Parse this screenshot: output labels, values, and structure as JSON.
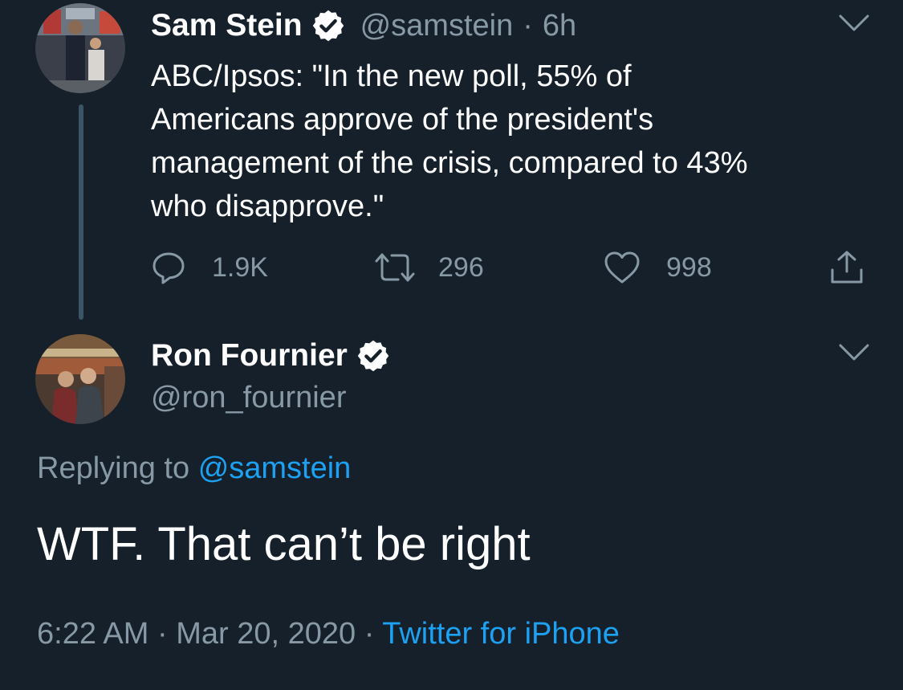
{
  "theme": {
    "background": "#15202b",
    "text_primary": "#ffffff",
    "text_secondary": "#8899a6",
    "link": "#1da1f2",
    "thread_line": "#3d5466"
  },
  "parent_tweet": {
    "author_name": "Sam Stein",
    "verified": true,
    "handle": "@samstein",
    "separator": "·",
    "time_ago": "6h",
    "text_lines": [
      "ABC/Ipsos: \"In the new poll, 55% of",
      "Americans approve of the president's",
      "management of the crisis, compared to 43%",
      "who disapprove.\""
    ],
    "actions": {
      "reply_icon": "comment-icon",
      "reply_count": "1.9K",
      "retweet_icon": "retweet-icon",
      "retweet_count": "296",
      "like_icon": "heart-icon",
      "like_count": "998",
      "share_icon": "share-icon"
    }
  },
  "reply_tweet": {
    "author_name": "Ron Fournier",
    "verified": true,
    "handle": "@ron_fournier",
    "replying_prefix": "Replying to",
    "replying_to": "@samstein",
    "text": "WTF. That can’t be right",
    "time": "6:22 AM",
    "separator_1": "·",
    "date": "Mar 20, 2020",
    "separator_2": "·",
    "source": "Twitter for iPhone"
  }
}
